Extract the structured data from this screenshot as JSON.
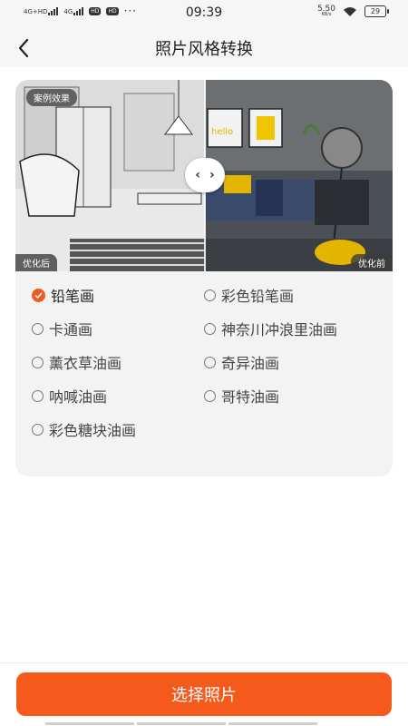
{
  "status_bar": {
    "sig1": "4G+HD",
    "sig2": "4G",
    "pill1": "HD",
    "pill2": "HD",
    "dots": "···",
    "time": "09:39",
    "net_speed": "5.50",
    "net_unit": "KB/s",
    "battery": "29"
  },
  "header": {
    "title": "照片风格转换",
    "back_icon": "back-arrow-icon"
  },
  "preview": {
    "case_label": "案例效果",
    "after_label": "优化后",
    "before_label": "优化前",
    "handle_left": "‹",
    "handle_right": "›",
    "art_text": "hello"
  },
  "styles": [
    {
      "label": "铅笔画",
      "selected": true
    },
    {
      "label": "彩色铅笔画",
      "selected": false
    },
    {
      "label": "卡通画",
      "selected": false
    },
    {
      "label": "神奈川冲浪里油画",
      "selected": false
    },
    {
      "label": "薰衣草油画",
      "selected": false
    },
    {
      "label": "奇异油画",
      "selected": false
    },
    {
      "label": "呐喊油画",
      "selected": false
    },
    {
      "label": "哥特油画",
      "selected": false
    },
    {
      "label": "彩色糖块油画",
      "selected": false
    }
  ],
  "colors": {
    "accent": "#f55a1c",
    "check": "#f05a22"
  },
  "action": {
    "label": "选择照片"
  }
}
